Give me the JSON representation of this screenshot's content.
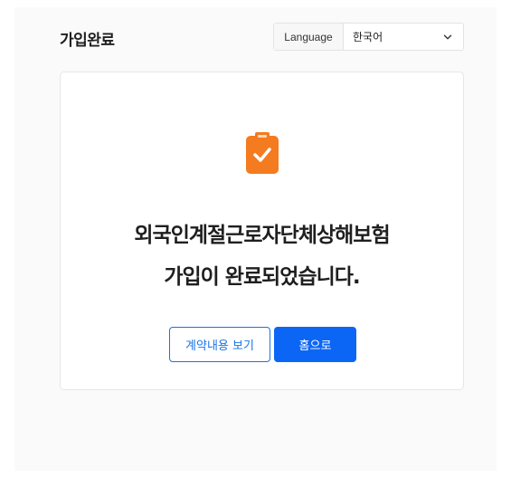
{
  "header": {
    "title": "가입완료",
    "language_label": "Language",
    "language_selected": "한국어"
  },
  "card": {
    "icon": "clipboard-check-icon",
    "message_line1": "외국인계절근로자단체상해보험",
    "message_line2": "가입이 완료되었습니다.",
    "buttons": {
      "view_contract": "계약내용 보기",
      "home": "홈으로"
    }
  },
  "colors": {
    "accent": "#0b66f5",
    "icon_orange": "#f47b20",
    "background": "#fafafa"
  }
}
